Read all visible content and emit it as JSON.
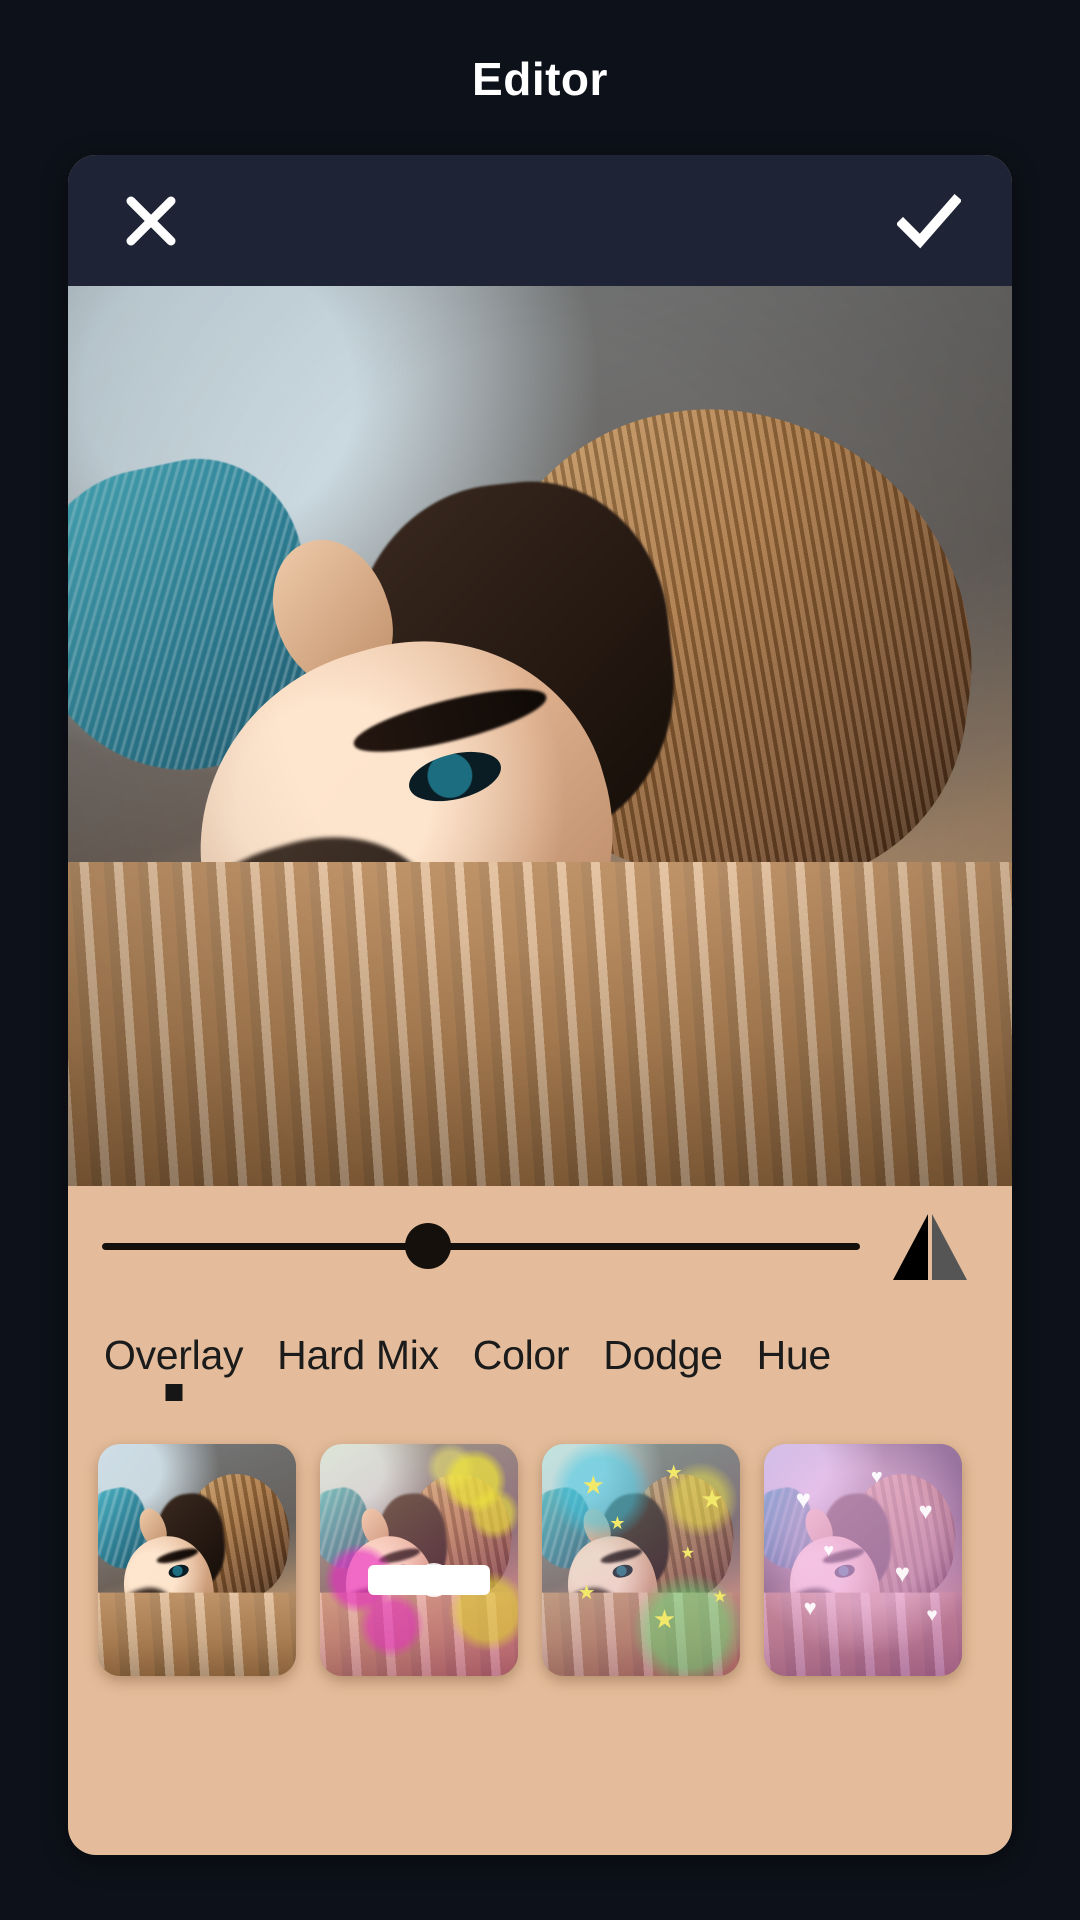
{
  "app": {
    "title": "Editor",
    "page_bg": "#0d1119",
    "card_bg": "#e4bc9b",
    "action_bar_bg": "#1e2436",
    "accent": "#ffffff"
  },
  "action_bar": {
    "cancel": {
      "name": "close-icon",
      "label": "Close"
    },
    "confirm": {
      "name": "check-icon",
      "label": "Apply"
    }
  },
  "preview": {
    "name": "photo-preview",
    "description": "Portrait of a man with sunglasses lying on woven fabric"
  },
  "opacity_slider": {
    "name": "opacity-slider",
    "value": 43,
    "min": 0,
    "max": 100,
    "track_color": "#15100c",
    "thumb_color": "#15100c"
  },
  "contrast_toggle": {
    "name": "contrast-icon",
    "label": "Contrast",
    "left_color": "#000000",
    "right_color": "#555555"
  },
  "blend_modes": {
    "selected_index": 0,
    "items": [
      {
        "label": "Overlay"
      },
      {
        "label": "Hard Mix"
      },
      {
        "label": "Color"
      },
      {
        "label": "Dodge"
      },
      {
        "label": "Hue"
      }
    ]
  },
  "thumbnails": {
    "selected_index": 0,
    "items": [
      {
        "name": "filter-thumb-original",
        "overlay": "none",
        "label": "Original"
      },
      {
        "name": "filter-thumb-bokeh",
        "overlay": "bokeh",
        "label": "Bokeh"
      },
      {
        "name": "filter-thumb-stars",
        "overlay": "stars",
        "label": "Stars"
      },
      {
        "name": "filter-thumb-hearts",
        "overlay": "hearts",
        "label": "Hearts"
      }
    ]
  }
}
